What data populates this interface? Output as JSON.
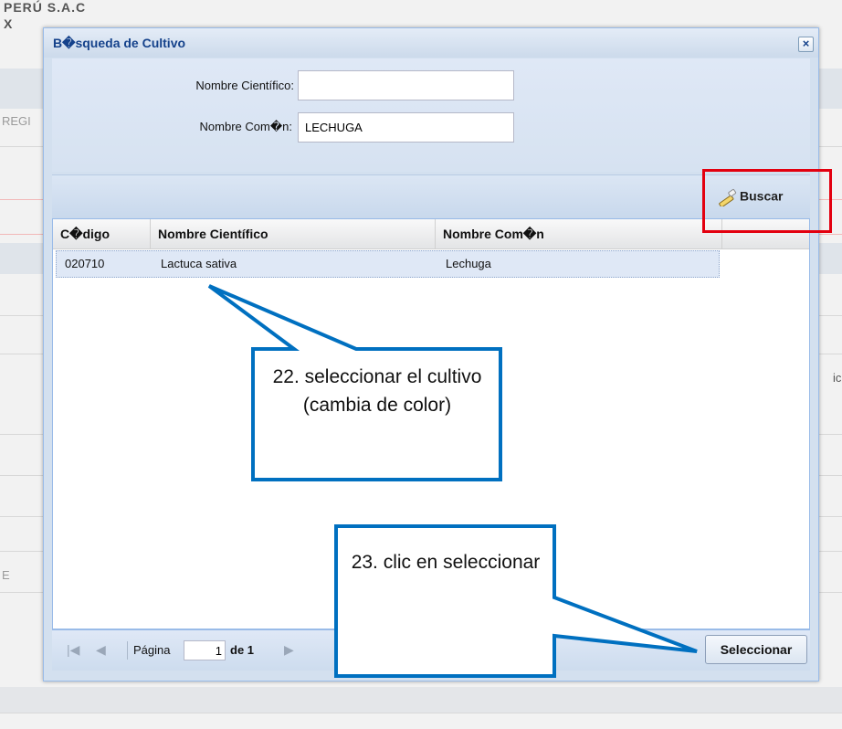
{
  "background": {
    "title": "PERÚ S.A.C",
    "x_text": "X",
    "regi_text": "REGI",
    "right_text": "ic",
    "left_e_text": "E"
  },
  "dialog": {
    "title": "B�squeda de Cultivo",
    "close_icon": "close-icon"
  },
  "form": {
    "nombre_cientifico_label": "Nombre Científico:",
    "nombre_cientifico_value": "",
    "nombre_comun_label": "Nombre Com�n:",
    "nombre_comun_value": "LECHUGA"
  },
  "toolbar": {
    "buscar_label": "Buscar",
    "buscar_icon": "search-wand-icon"
  },
  "grid": {
    "columns": [
      "C�digo",
      "Nombre Científico",
      "Nombre Com�n"
    ],
    "rows": [
      {
        "codigo": "020710",
        "cientifico": "Lactuca sativa",
        "comun": "Lechuga"
      }
    ]
  },
  "pager": {
    "page_label": "Página",
    "page_value": "1",
    "of_label": "de 1",
    "seleccionar_label": "Seleccionar"
  },
  "callouts": {
    "select_crop": "22. seleccionar el cultivo (cambia de color)",
    "click_select": "23. clic en seleccionar"
  },
  "colors": {
    "callout_border": "#0070c0",
    "highlight": "#e3000f",
    "dialog_title": "#15428b",
    "selected_row": "#dfe8f6"
  }
}
